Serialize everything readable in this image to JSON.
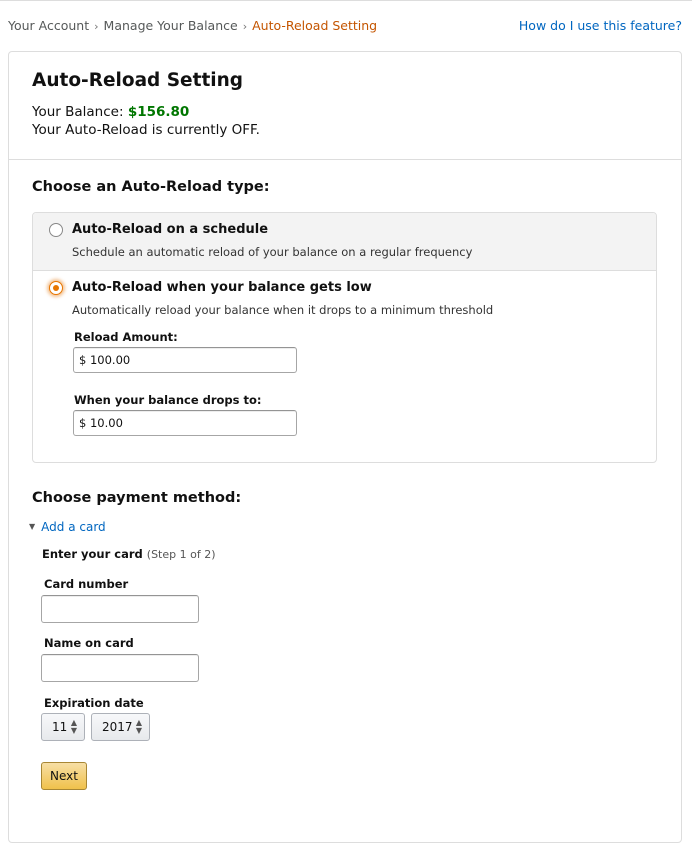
{
  "breadcrumb": {
    "items": [
      "Your Account",
      "Manage Your Balance",
      "Auto-Reload Setting"
    ],
    "separator": "›"
  },
  "help_link": "How do I use this feature?",
  "header": {
    "title": "Auto-Reload Setting",
    "balance_label": "Your Balance:",
    "balance_value": "$156.80",
    "status_text": "Your Auto-Reload is currently OFF."
  },
  "reload_type": {
    "heading": "Choose an Auto-Reload type:",
    "options": [
      {
        "title": "Auto-Reload on a schedule",
        "desc": "Schedule an automatic reload of your balance on a regular frequency",
        "selected": false
      },
      {
        "title": "Auto-Reload when your balance gets low",
        "desc": "Automatically reload your balance when it drops to a minimum threshold",
        "selected": true
      }
    ],
    "reload_amount_label": "Reload Amount:",
    "reload_amount_value": "$ 100.00",
    "threshold_label": "When your balance drops to:",
    "threshold_value": "$ 10.00"
  },
  "payment": {
    "heading": "Choose payment method:",
    "add_card": "Add a card",
    "enter_card": "Enter your card",
    "step": "(Step 1 of 2)",
    "card_number_label": "Card number",
    "card_number_value": "",
    "name_label": "Name on card",
    "name_value": "",
    "expiration_label": "Expiration date",
    "exp_month": "11",
    "exp_year": "2017",
    "next_button": "Next"
  },
  "colors": {
    "link": "#0066c0",
    "active_crumb": "#c45500",
    "balance": "#007600",
    "radio_selected": "#e77600",
    "button": "#f0c14b"
  }
}
